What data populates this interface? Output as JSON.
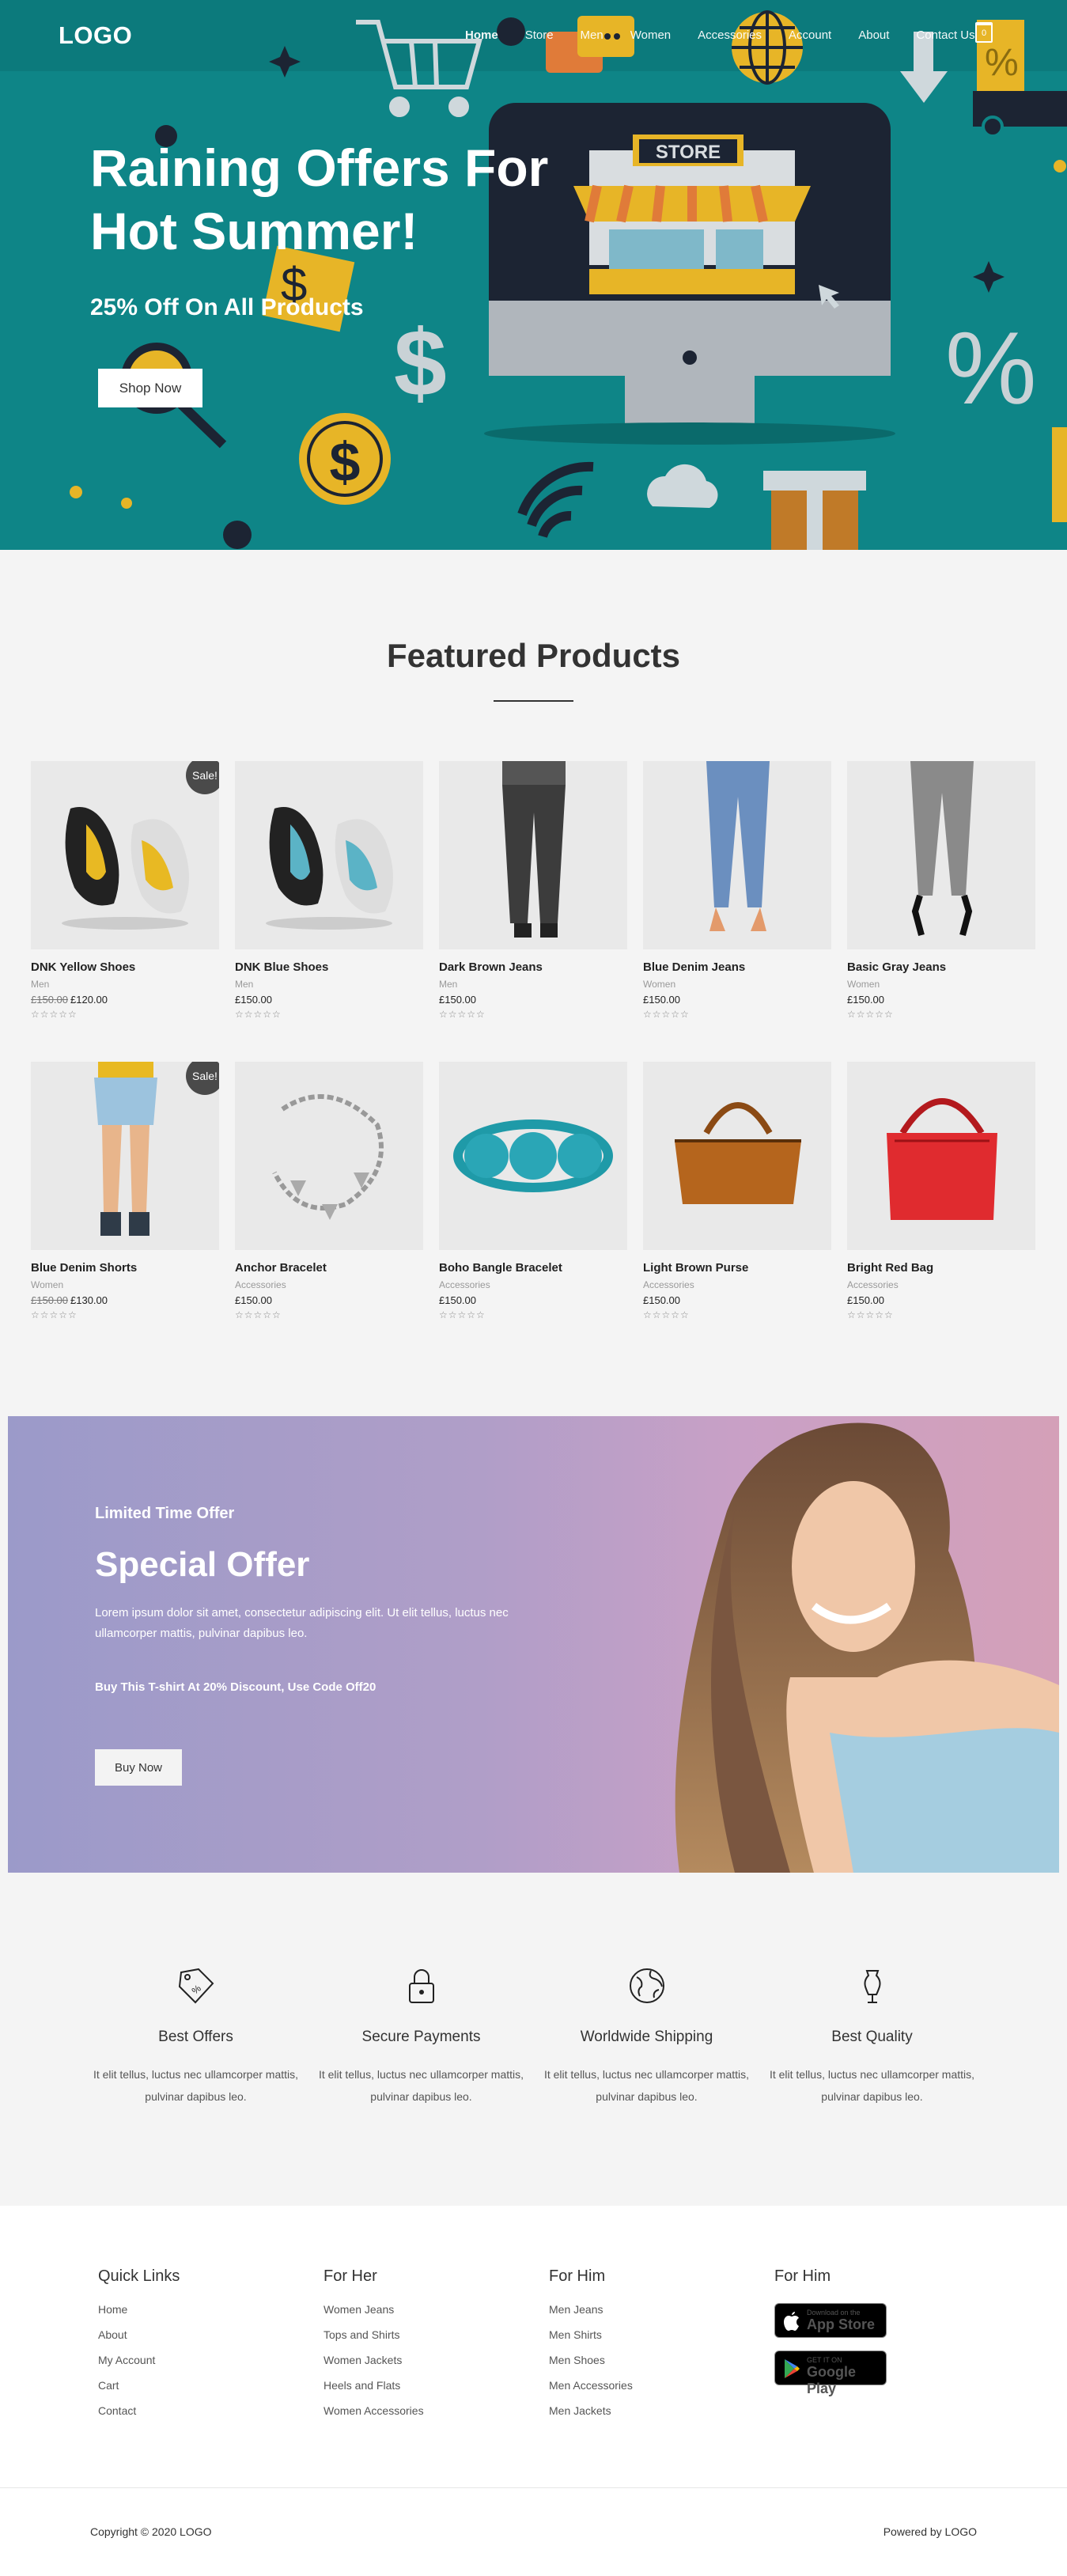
{
  "header": {
    "logo": "LOGO",
    "nav": [
      "Home",
      "Store",
      "Men",
      "Women",
      "Accessories",
      "Account",
      "About",
      "Contact Us"
    ],
    "cart_count": "0"
  },
  "hero": {
    "title": "Raining Offers For Hot Summer!",
    "subtitle": "25% Off On All Products",
    "button": "Shop Now",
    "store_sign": "STORE"
  },
  "featured": {
    "title": "Featured Products",
    "sale_label": "Sale!",
    "products": [
      {
        "name": "DNK Yellow Shoes",
        "category": "Men",
        "old_price": "£150.00",
        "price": "£120.00",
        "sale": true,
        "icon": "yellow-shoes"
      },
      {
        "name": "DNK Blue Shoes",
        "category": "Men",
        "old_price": "",
        "price": "£150.00",
        "sale": false,
        "icon": "blue-shoes"
      },
      {
        "name": "Dark Brown Jeans",
        "category": "Men",
        "old_price": "",
        "price": "£150.00",
        "sale": false,
        "icon": "dark-jeans"
      },
      {
        "name": "Blue Denim Jeans",
        "category": "Women",
        "old_price": "",
        "price": "£150.00",
        "sale": false,
        "icon": "blue-jeans"
      },
      {
        "name": "Basic Gray Jeans",
        "category": "Women",
        "old_price": "",
        "price": "£150.00",
        "sale": false,
        "icon": "gray-jeans"
      },
      {
        "name": "Blue Denim Shorts",
        "category": "Women",
        "old_price": "£150.00",
        "price": "£130.00",
        "sale": true,
        "icon": "denim-shorts"
      },
      {
        "name": "Anchor Bracelet",
        "category": "Accessories",
        "old_price": "",
        "price": "£150.00",
        "sale": false,
        "icon": "anchor-bracelet"
      },
      {
        "name": "Boho Bangle Bracelet",
        "category": "Accessories",
        "old_price": "",
        "price": "£150.00",
        "sale": false,
        "icon": "bangle-bracelet"
      },
      {
        "name": "Light Brown Purse",
        "category": "Accessories",
        "old_price": "",
        "price": "£150.00",
        "sale": false,
        "icon": "brown-purse"
      },
      {
        "name": "Bright Red Bag",
        "category": "Accessories",
        "old_price": "",
        "price": "£150.00",
        "sale": false,
        "icon": "red-bag"
      }
    ]
  },
  "offer": {
    "kicker": "Limited Time Offer",
    "title": "Special Offer",
    "description": "Lorem ipsum dolor sit amet, consectetur adipiscing elit. Ut elit tellus, luctus nec ullamcorper mattis, pulvinar dapibus leo.",
    "code_text": "Buy This T-shirt At 20% Discount, Use Code Off20",
    "button": "Buy Now"
  },
  "features": [
    {
      "title": "Best Offers",
      "text": "It elit tellus, luctus nec ullamcorper mattis, pulvinar dapibus leo.",
      "icon": "price-tag-icon"
    },
    {
      "title": "Secure Payments",
      "text": "It elit tellus, luctus nec ullamcorper mattis, pulvinar dapibus leo.",
      "icon": "lock-icon"
    },
    {
      "title": "Worldwide Shipping",
      "text": "It elit tellus, luctus nec ullamcorper mattis, pulvinar dapibus leo.",
      "icon": "globe-icon"
    },
    {
      "title": "Best Quality",
      "text": "It elit tellus, luctus nec ullamcorper mattis, pulvinar dapibus leo.",
      "icon": "dress-form-icon"
    }
  ],
  "footer": {
    "columns": [
      {
        "title": "Quick Links",
        "links": [
          "Home",
          "About",
          "My Account",
          "Cart",
          "Contact"
        ]
      },
      {
        "title": "For Her",
        "links": [
          "Women Jeans",
          "Tops and Shirts",
          "Women Jackets",
          "Heels and Flats",
          "Women Accessories"
        ]
      },
      {
        "title": "For Him",
        "links": [
          "Men Jeans",
          "Men Shirts",
          "Men Shoes",
          "Men Accessories",
          "Men Jackets"
        ]
      },
      {
        "title": "For Him",
        "links": []
      }
    ],
    "app_store": {
      "small": "Download on the",
      "large": "App Store"
    },
    "google_play": {
      "small": "GET IT ON",
      "large": "Google Play"
    },
    "copyright": "Copyright © 2020 LOGO",
    "powered": "Powered by LOGO"
  },
  "colors": {
    "hero_bg": "#0e8587",
    "accent_yellow": "#e7b527",
    "dark": "#1c2433"
  }
}
